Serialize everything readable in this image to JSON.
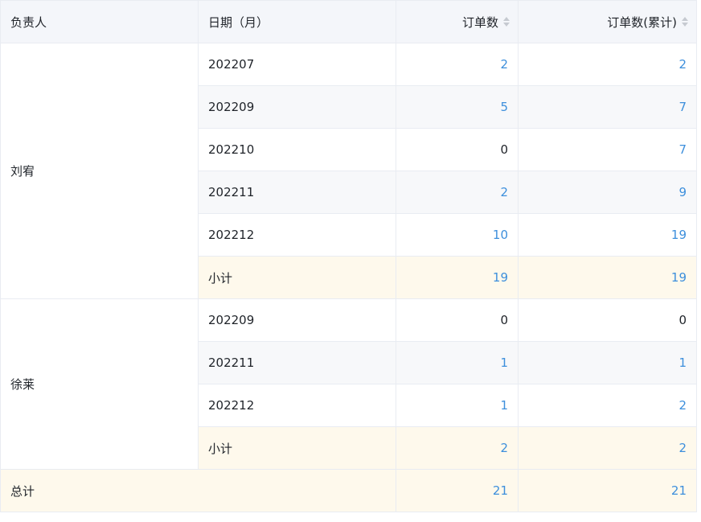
{
  "headers": {
    "owner": "负责人",
    "date": "日期（月）",
    "orders": "订单数",
    "orders_cum": "订单数(累计)"
  },
  "icons": {
    "sort": "sort-icon"
  },
  "colors": {
    "header_bg": "#f4f6fa",
    "stripe_bg": "#f7f8fa",
    "subtotal_bg": "#fef9ec",
    "link_blue": "#3d8fdc",
    "border": "#e9ecf2"
  },
  "groups": [
    {
      "owner": "刘宥",
      "rows": [
        {
          "date": "202207",
          "orders": "2",
          "orders_cum": "2"
        },
        {
          "date": "202209",
          "orders": "5",
          "orders_cum": "7"
        },
        {
          "date": "202210",
          "orders": "0",
          "orders_cum": "7"
        },
        {
          "date": "202211",
          "orders": "2",
          "orders_cum": "9"
        },
        {
          "date": "202212",
          "orders": "10",
          "orders_cum": "19"
        }
      ],
      "subtotal": {
        "label": "小计",
        "orders": "19",
        "orders_cum": "19"
      }
    },
    {
      "owner": "徐莱",
      "rows": [
        {
          "date": "202209",
          "orders": "0",
          "orders_cum": "0"
        },
        {
          "date": "202211",
          "orders": "1",
          "orders_cum": "1"
        },
        {
          "date": "202212",
          "orders": "1",
          "orders_cum": "2"
        }
      ],
      "subtotal": {
        "label": "小计",
        "orders": "2",
        "orders_cum": "2"
      }
    }
  ],
  "total": {
    "label": "总计",
    "orders": "21",
    "orders_cum": "21"
  }
}
